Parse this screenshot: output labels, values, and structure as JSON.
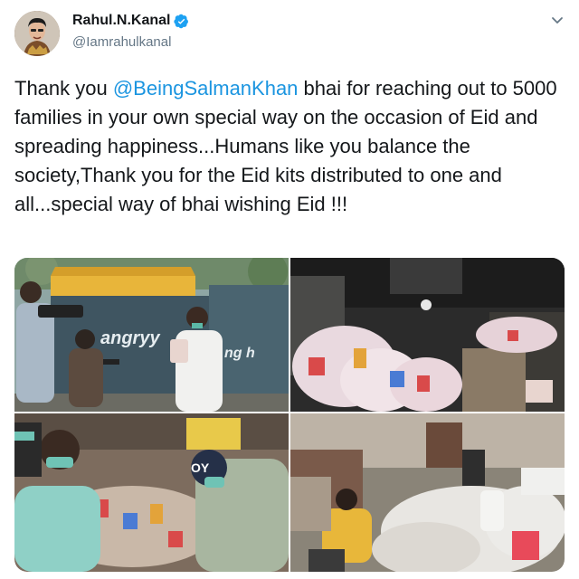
{
  "user": {
    "name": "Rahul.N.Kanal",
    "handle": "@Iamrahulkanal",
    "verified_icon": "verified-badge-icon"
  },
  "tweet": {
    "text_before": "Thank you ",
    "mention": "@BeingSalmanKhan",
    "text_after": " bhai for reaching out to 5000 families in your own special way on the occasion of Eid and spreading happiness...Humans like you balance the society,Thank you for the Eid kits distributed to one and all...special way of bhai wishing Eid !!!"
  },
  "media": {
    "photo1": {
      "truck_text_1": "angryy",
      "truck_text_2": "ng h"
    },
    "photo_count": 4
  },
  "colors": {
    "mention": "#1b95e0",
    "verified": "#1da1f2",
    "handle": "#657786",
    "text": "#14171a"
  }
}
